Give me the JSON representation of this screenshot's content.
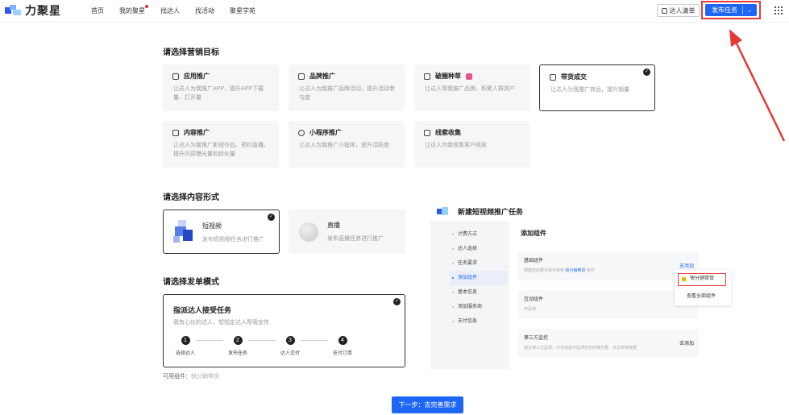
{
  "header": {
    "logo_text": "力聚星",
    "nav": [
      {
        "label": "首页"
      },
      {
        "label": "我的聚星"
      },
      {
        "label": "找达人"
      },
      {
        "label": "找活动"
      },
      {
        "label": "聚星学苑"
      }
    ],
    "talent_list_label": "达人清单",
    "publish_label": "发布任务"
  },
  "marketing": {
    "title": "请选择营销目标",
    "cards": [
      {
        "title": "应用推广",
        "desc": "让达人为我推广APP，提升APP下载量、打开量"
      },
      {
        "title": "品牌推广",
        "desc": "让达人为我推广品牌活动，提升活动参与度"
      },
      {
        "title": "破圈种草",
        "desc": "让达人帮我推广品牌，积累人群资产"
      },
      {
        "title": "带货成交",
        "desc": "让达人为我推广商品，提升销量"
      },
      {
        "title": "内容推广",
        "desc": "让达人为我推广影视作品、预约直播，提升内容曝光量和转化量"
      },
      {
        "title": "小程序推广",
        "desc": "让达人为我推广小程序，提升活跃度"
      },
      {
        "title": "线索收集",
        "desc": "让达人为我收集客户线索"
      }
    ]
  },
  "content": {
    "title": "请选择内容形式",
    "cards": [
      {
        "title": "短视频",
        "desc": "发布短视频任务进行推广"
      },
      {
        "title": "直播",
        "desc": "发布直播任务进行推广"
      }
    ]
  },
  "mode": {
    "title": "请选择发单模式",
    "card_title": "指派达人接受任务",
    "card_desc": "我有心仪的达人，想指定达人帮我宣传",
    "steps": [
      {
        "num": "1",
        "label": "选择达人"
      },
      {
        "num": "2",
        "label": "发布任务"
      },
      {
        "num": "3",
        "label": "达人交付"
      },
      {
        "num": "4",
        "label": "支付订单"
      }
    ],
    "available_label": "可用组件：",
    "available_value": "快分销带货"
  },
  "next_button": "下一步：去完善需求",
  "preview": {
    "title": "新建短视频推广任务",
    "sidebar": [
      "计费方式",
      "达人选择",
      "任务要求",
      "添加组件",
      "基本信息",
      "添加服务商",
      "支付信息"
    ],
    "main_title": "添加组件",
    "sections": [
      {
        "title": "基础组件",
        "desc_a": "根据您的要求组件推荐",
        "desc_link": "快分销带货",
        "desc_b": "组件",
        "link": "去添加"
      },
      {
        "title": "互动组件",
        "desc_a": "可添加",
        "desc_link": "",
        "desc_b": "",
        "link": ""
      },
      {
        "title": "第三方监控",
        "desc_a": "通过第三方监测，可在动态中监测任务的曝光量、点击率等数据",
        "desc_link": "",
        "desc_b": "",
        "link": "去添加"
      }
    ],
    "popup_option1": "快分销带货",
    "popup_option2": "查看全部组件"
  }
}
